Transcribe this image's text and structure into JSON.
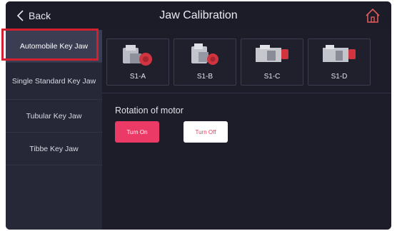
{
  "header": {
    "back_label": "Back",
    "title": "Jaw Calibration",
    "home_icon": "home-icon",
    "back_icon": "chevron-left-icon"
  },
  "sidebar": {
    "items": [
      {
        "label": "Automobile Key Jaw",
        "active": true
      },
      {
        "label": "Single Standard Key Jaw",
        "active": false
      },
      {
        "label": "Tubular Key Jaw",
        "active": false
      },
      {
        "label": "Tibbe Key Jaw",
        "active": false
      }
    ]
  },
  "jaws": [
    {
      "label": "S1-A"
    },
    {
      "label": "S1-B"
    },
    {
      "label": "S1-C"
    },
    {
      "label": "S1-D"
    }
  ],
  "motor": {
    "label": "Rotation of motor",
    "turn_on": "Turn On",
    "turn_off": "Turn Off"
  },
  "colors": {
    "accent": "#ec3a67",
    "highlight": "#d3202f",
    "home_icon": "#e05a5a"
  }
}
